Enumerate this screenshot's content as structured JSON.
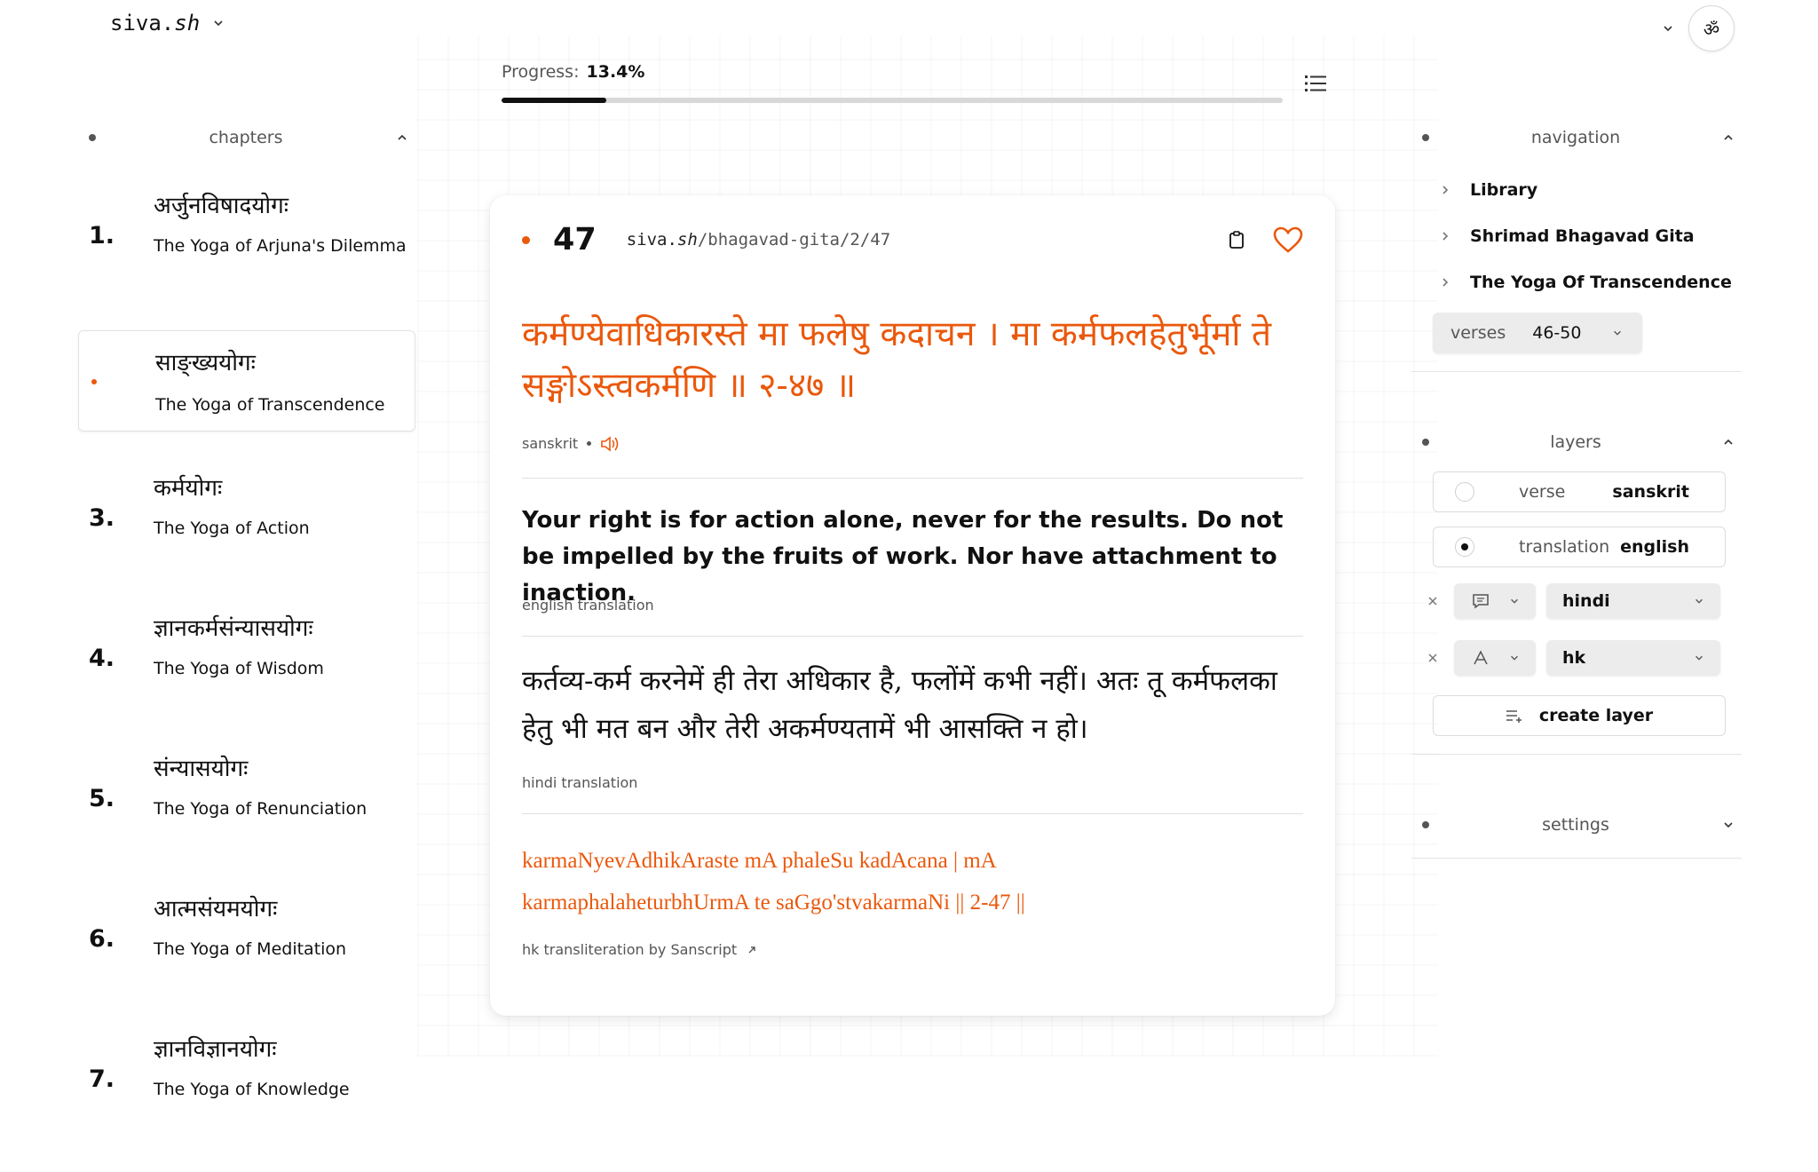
{
  "app": {
    "brand_main": "siva.",
    "brand_sh": "sh"
  },
  "top": {
    "om_symbol": "ॐ",
    "chev": "⌄"
  },
  "progress": {
    "label": "Progress:",
    "value_text": "13.4%",
    "value": 13.4
  },
  "left": {
    "title": "chapters",
    "chapters": [
      {
        "num": "1.",
        "skt": "अर्जुनविषादयोगः",
        "eng": "The Yoga of Arjuna's Dilemma"
      },
      {
        "num": "2.",
        "skt": "साङ्ख्ययोगः",
        "eng": "The Yoga of Transcendence",
        "active": true
      },
      {
        "num": "3.",
        "skt": "कर्मयोगः",
        "eng": "The Yoga of Action"
      },
      {
        "num": "4.",
        "skt": "ज्ञानकर्मसंन्यासयोगः",
        "eng": "The Yoga of Wisdom"
      },
      {
        "num": "5.",
        "skt": "संन्यासयोगः",
        "eng": "The Yoga of Renunciation"
      },
      {
        "num": "6.",
        "skt": "आत्मसंयमयोगः",
        "eng": "The Yoga of Meditation"
      },
      {
        "num": "7.",
        "skt": "ज्ञानविज्ञानयोगः",
        "eng": "The Yoga of Knowledge"
      }
    ]
  },
  "card": {
    "verse_num": "47",
    "url_main": "siva.",
    "url_sh": "sh",
    "url_path": "/bhagavad-gita/2/47",
    "sanskrit": "कर्मण्येवाधिकारस्ते मा फलेषु कदाचन । मा कर्मफलहेतुर्भूर्मा ते सङ्गोऽस्त्वकर्मणि ॥ २-४७ ॥",
    "sanskrit_caption": "sanskrit",
    "english": "Your right is for action alone, never for the results. Do not be impelled by the fruits of work. Nor have attachment to inaction.",
    "english_caption": "english translation",
    "hindi": "कर्तव्य-कर्म करनेमें ही तेरा अधिकार है, फलोंमें कभी नहीं। अतः तू कर्मफलका हेतु भी मत बन और तेरी अकर्मण्यतामें भी आसक्ति न हो।",
    "hindi_caption": "hindi translation",
    "hk_line1": "karmaNyevAdhikAraste mA phaleSu kadAcana | mA",
    "hk_line2": "karmaphalaheturbhUrmA te saGgo'stvakarmaNi || 2-47 ||",
    "hk_caption": "hk transliteration by Sanscript",
    "accent_color": "#ea580c"
  },
  "right": {
    "navigation": {
      "title": "navigation",
      "items": [
        "Library",
        "Shrimad Bhagavad Gita",
        "The Yoga Of Transcendence"
      ],
      "verses_label": "verses",
      "verses_value": "46-50"
    },
    "layers": {
      "title": "layers",
      "rows": [
        {
          "key": "verse",
          "value": "sanskrit",
          "selected": false
        },
        {
          "key": "translation",
          "value": "english",
          "selected": true
        }
      ],
      "controls": [
        {
          "icon": "comment-icon",
          "value": "hindi"
        },
        {
          "icon": "font-icon",
          "value": "hk"
        }
      ],
      "create_label": "create layer"
    },
    "settings": {
      "title": "settings"
    }
  }
}
